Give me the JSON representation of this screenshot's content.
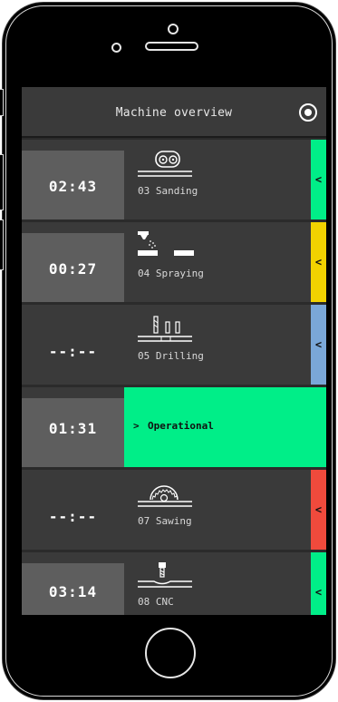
{
  "header": {
    "title": "Machine overview",
    "icon": "target-icon"
  },
  "machines": [
    {
      "time": "02:43",
      "label": "03 Sanding",
      "icon": "sanding-machine-icon",
      "status_color": "#00ee88",
      "chevron": "<",
      "time_box": "filled"
    },
    {
      "time": "00:27",
      "label": "04 Spraying",
      "icon": "spraying-machine-icon",
      "status_color": "#f2d200",
      "chevron": "<",
      "time_box": "filled"
    },
    {
      "time": "--:--",
      "label": "05 Drilling",
      "icon": "drilling-machine-icon",
      "status_color": "#7aa7d8",
      "chevron": "<",
      "time_box": "none"
    },
    {
      "time": "01:31",
      "label": "Operational",
      "expanded": true,
      "status_color": "#00ee88",
      "chevron": ">",
      "time_box": "filled"
    },
    {
      "time": "--:--",
      "label": "07 Sawing",
      "icon": "sawing-machine-icon",
      "status_color": "#f04a3c",
      "chevron": "<",
      "time_box": "none"
    },
    {
      "time": "03:14",
      "label": "08 CNC",
      "icon": "cnc-machine-icon",
      "status_color": "#00ee88",
      "chevron": "<",
      "time_box": "filled"
    }
  ]
}
